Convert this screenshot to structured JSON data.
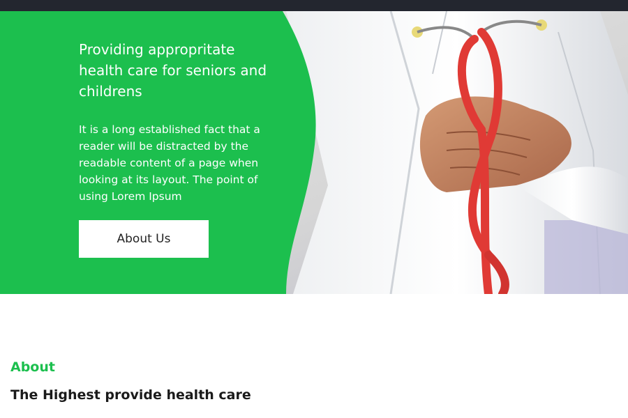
{
  "hero": {
    "title": "Providing appropritate health care for seniors and childrens",
    "description": "It is a long established fact that a reader will be distracted by the readable content of a page when looking at its layout. The point of using Lorem Ipsum",
    "button_label": "About Us",
    "accent_color": "#1cbf4e"
  },
  "about": {
    "label": "About",
    "heading": "The Highest provide health care"
  }
}
